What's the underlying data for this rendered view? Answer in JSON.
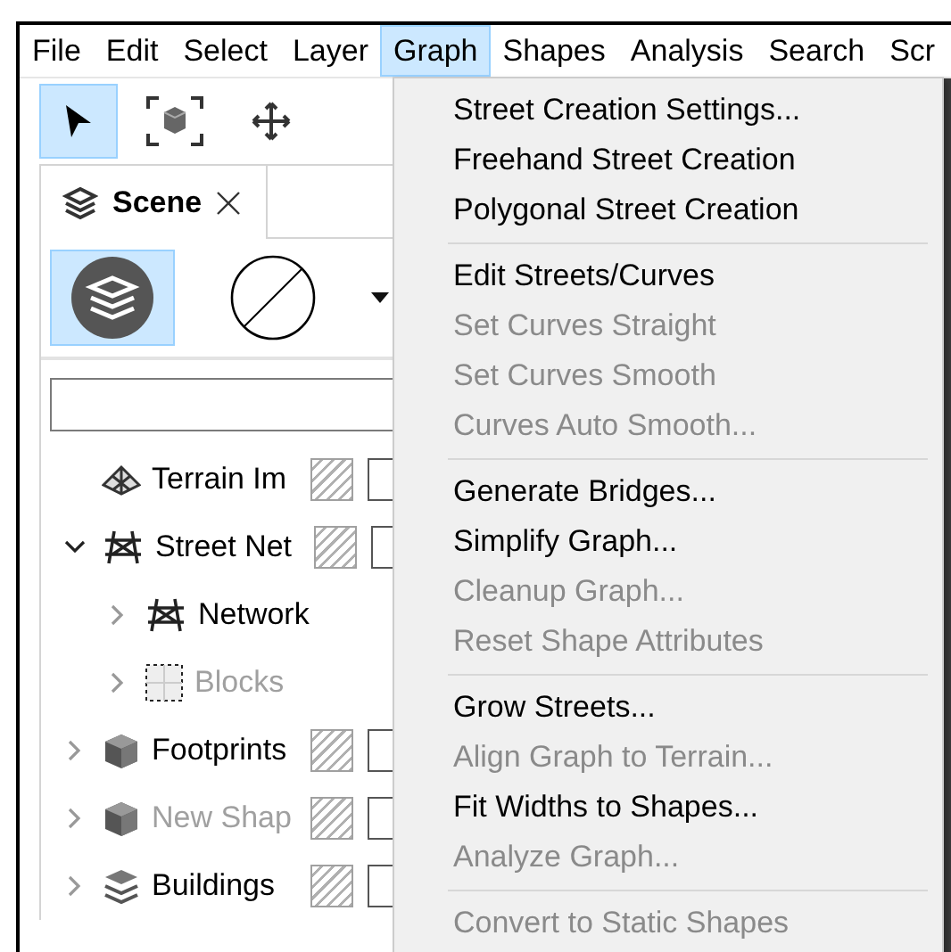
{
  "menubar": [
    {
      "label": "File",
      "selected": false
    },
    {
      "label": "Edit",
      "selected": false
    },
    {
      "label": "Select",
      "selected": false
    },
    {
      "label": "Layer",
      "selected": false
    },
    {
      "label": "Graph",
      "selected": true
    },
    {
      "label": "Shapes",
      "selected": false
    },
    {
      "label": "Analysis",
      "selected": false
    },
    {
      "label": "Search",
      "selected": false
    },
    {
      "label": "Scr",
      "selected": false
    }
  ],
  "toolbar": [
    {
      "kind": "pointer",
      "selected": true
    },
    {
      "kind": "frame",
      "selected": false
    },
    {
      "kind": "move",
      "selected": false
    }
  ],
  "panel": {
    "tab": {
      "label": "Scene",
      "selected": true
    },
    "modes": [
      {
        "kind": "layers",
        "selected": true
      },
      {
        "kind": "none",
        "selected": false
      }
    ],
    "tree": [
      {
        "name": "Terrain Im",
        "kind": "terrain",
        "disabled": false
      },
      {
        "name": "Street Net",
        "kind": "street",
        "disabled": false,
        "expanded": true,
        "children": [
          {
            "name": "Network",
            "kind": "street",
            "disabled": false,
            "expanded": false
          },
          {
            "name": "Blocks",
            "kind": "blocks",
            "disabled": true,
            "expanded": false
          }
        ]
      },
      {
        "name": "Footprints",
        "kind": "cube",
        "disabled": false,
        "expanded": false
      },
      {
        "name": "New Shap",
        "kind": "cube",
        "disabled": true,
        "expanded": false
      },
      {
        "name": "Buildings",
        "kind": "stack",
        "disabled": false,
        "expanded": false
      }
    ]
  },
  "menu": {
    "groups": [
      [
        {
          "label": "Street Creation Settings...",
          "disabled": false
        },
        {
          "label": "Freehand Street Creation",
          "disabled": false
        },
        {
          "label": "Polygonal Street Creation",
          "disabled": false
        }
      ],
      [
        {
          "label": "Edit Streets/Curves",
          "disabled": false
        },
        {
          "label": "Set Curves Straight",
          "disabled": true
        },
        {
          "label": "Set Curves Smooth",
          "disabled": true
        },
        {
          "label": "Curves Auto Smooth...",
          "disabled": true
        }
      ],
      [
        {
          "label": "Generate Bridges...",
          "disabled": false
        },
        {
          "label": "Simplify Graph...",
          "disabled": false
        },
        {
          "label": "Cleanup Graph...",
          "disabled": true
        },
        {
          "label": "Reset Shape Attributes",
          "disabled": true
        }
      ],
      [
        {
          "label": "Grow Streets...",
          "disabled": false
        },
        {
          "label": "Align Graph to Terrain...",
          "disabled": true
        },
        {
          "label": "Fit Widths to Shapes...",
          "disabled": false
        },
        {
          "label": "Analyze Graph...",
          "disabled": true
        }
      ],
      [
        {
          "label": "Convert to Static Shapes",
          "disabled": true
        }
      ]
    ]
  }
}
